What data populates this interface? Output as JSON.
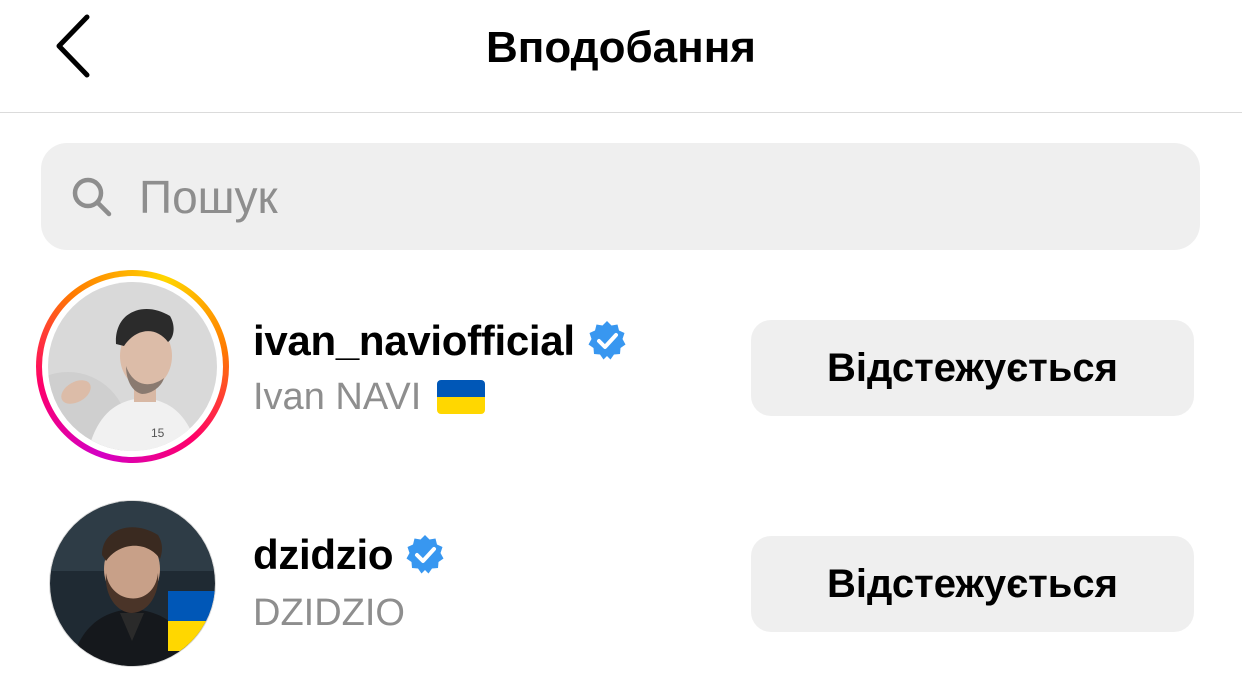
{
  "header": {
    "title": "Вподобання",
    "back_icon": "chevron-left-icon"
  },
  "search": {
    "placeholder": "Пошук",
    "value": "",
    "icon": "search-icon"
  },
  "users": [
    {
      "username": "ivan_naviofficial",
      "verified": true,
      "full_name": "Ivan NAVI",
      "full_name_emoji": "ukraine-flag",
      "has_story_ring": true,
      "button_label": "Відстежується"
    },
    {
      "username": "dzidzio",
      "verified": true,
      "full_name": "DZIDZIO",
      "has_story_ring": false,
      "button_label": "Відстежується"
    }
  ],
  "colors": {
    "verified_badge": "#3897f0",
    "button_bg": "#efefef",
    "secondary_text": "#8e8e8e",
    "search_bg": "#efefef",
    "flag_blue": "#0057b7",
    "flag_yellow": "#ffd700"
  }
}
